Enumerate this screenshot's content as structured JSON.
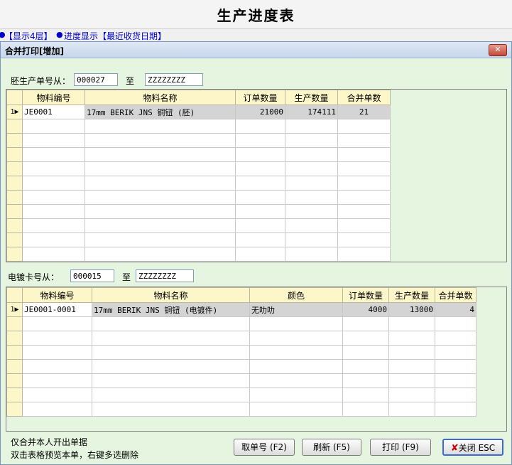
{
  "app": {
    "title": "生产进度表"
  },
  "nav": {
    "item1": "【显示4层】",
    "item2": "进度显示【最近收货日期】"
  },
  "dialog": {
    "title": "合并打印[增加]",
    "close_glyph": "✕",
    "blank_filter": {
      "label": "胚生产单号从：",
      "from": "000027",
      "to_label": "至",
      "to": "ZZZZZZZZ"
    },
    "blank_table": {
      "columns": [
        "物料编号",
        "物料名称",
        "订单数量",
        "生产数量",
        "合并单数"
      ],
      "rows": [
        {
          "row_no": "1",
          "code": "JE0001",
          "name": "17mm BERIK JNS 铜钮 (胚)",
          "order_qty": "21000",
          "prod_qty": "174111",
          "merge_count": "21"
        }
      ]
    },
    "plate_filter": {
      "label": "电镀卡号从：",
      "from": "000015",
      "to_label": "至",
      "to": "ZZZZZZZZ"
    },
    "plate_table": {
      "columns": [
        "物料编号",
        "物料名称",
        "颜色",
        "订单数量",
        "生产数量",
        "合并单数"
      ],
      "rows": [
        {
          "row_no": "1",
          "code": "JE0001-0001",
          "name": "17mm BERIK JNS 铜钮 (电镀件)",
          "color": "无叻叻",
          "order_qty": "4000",
          "prod_qty": "13000",
          "merge_count": "4"
        }
      ]
    },
    "notes": {
      "line1": "仅合并本人开出单据",
      "line2": "双击表格预览本单，右键多选删除"
    },
    "buttons": {
      "fetch": "取单号 (F2)",
      "refresh": "刷新 (F5)",
      "print": "打印 (F9)",
      "close": "关闭 ESC"
    }
  }
}
